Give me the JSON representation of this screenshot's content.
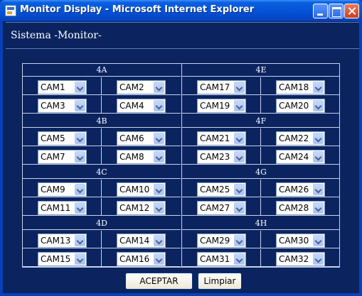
{
  "window": {
    "title": "Monitor Display - Microsoft Internet Explorer"
  },
  "page": {
    "heading": "Sistema -Monitor-"
  },
  "groups_left": [
    {
      "name": "4A",
      "rows": [
        [
          "CAM1",
          "CAM2"
        ],
        [
          "CAM3",
          "CAM4"
        ]
      ]
    },
    {
      "name": "4B",
      "rows": [
        [
          "CAM5",
          "CAM6"
        ],
        [
          "CAM7",
          "CAM8"
        ]
      ]
    },
    {
      "name": "4C",
      "rows": [
        [
          "CAM9",
          "CAM10"
        ],
        [
          "CAM11",
          "CAM12"
        ]
      ]
    },
    {
      "name": "4D",
      "rows": [
        [
          "CAM13",
          "CAM14"
        ],
        [
          "CAM15",
          "CAM16"
        ]
      ]
    }
  ],
  "groups_right": [
    {
      "name": "4E",
      "rows": [
        [
          "CAM17",
          "CAM18"
        ],
        [
          "CAM19",
          "CAM20"
        ]
      ]
    },
    {
      "name": "4F",
      "rows": [
        [
          "CAM21",
          "CAM22"
        ],
        [
          "CAM23",
          "CAM24"
        ]
      ]
    },
    {
      "name": "4G",
      "rows": [
        [
          "CAM25",
          "CAM26"
        ],
        [
          "CAM27",
          "CAM28"
        ]
      ]
    },
    {
      "name": "4H",
      "rows": [
        [
          "CAM29",
          "CAM30"
        ],
        [
          "CAM31",
          "CAM32"
        ]
      ]
    }
  ],
  "buttons": {
    "accept": "ACEPTAR",
    "clear": "Limpiar"
  },
  "colors": {
    "background": "#0b2460",
    "title_bar": "#0553d8",
    "grid_lines": "#c8d2ea"
  }
}
